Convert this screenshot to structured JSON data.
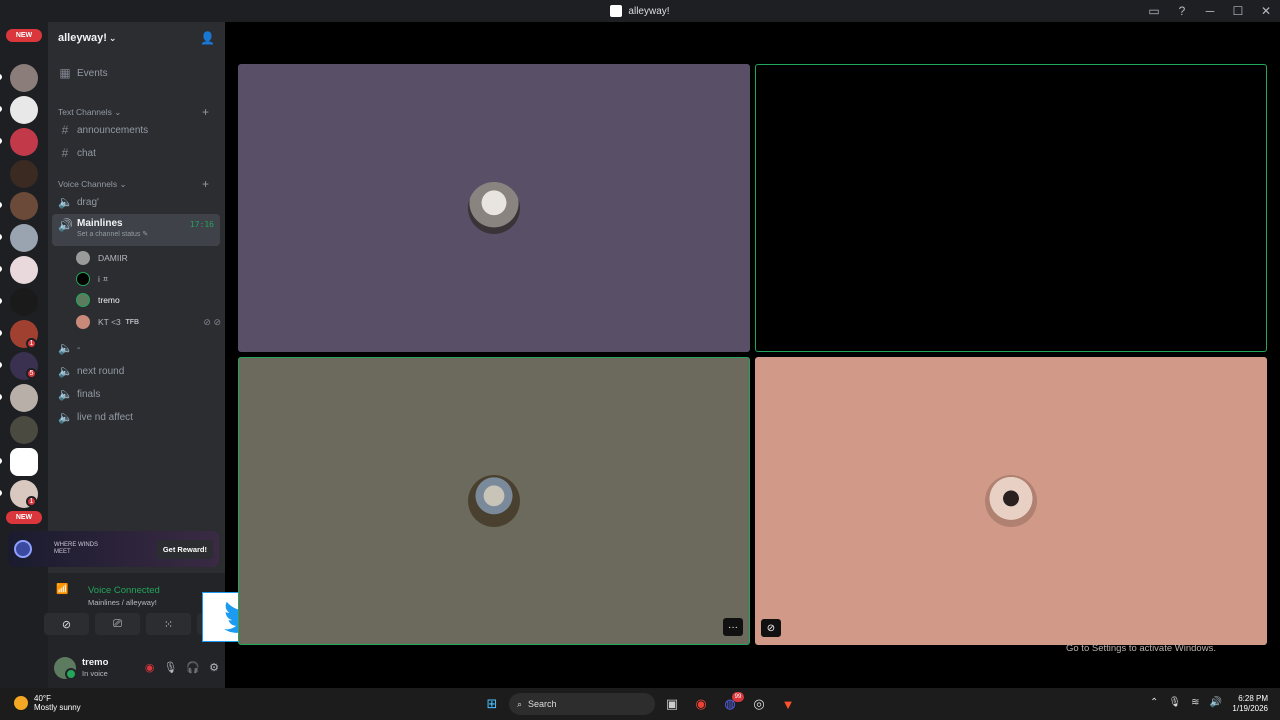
{
  "window": {
    "title": "alleyway!"
  },
  "server_rail": {
    "new_label": "NEW",
    "badge_1": "1",
    "badge_5": "5",
    "badge_1b": "1"
  },
  "server": {
    "name": "alleyway!"
  },
  "channels": {
    "events": "Events",
    "text_category": "Text Channels",
    "announcements": "announcements",
    "chat": "chat",
    "voice_category": "Voice Channels",
    "drag": "drag'",
    "mainlines": "Mainlines",
    "mainlines_time": "17:16",
    "status_prompt": "Set a channel status",
    "dash": "-",
    "next_round": "next round",
    "finals": "finals",
    "live": "live nd affect"
  },
  "voice_users": [
    {
      "name": "DAMIIR",
      "tag": ""
    },
    {
      "name": "i",
      "tag": "ㅍ"
    },
    {
      "name": "tremo",
      "tag": ""
    },
    {
      "name": "KT <3",
      "tag": "TFB"
    }
  ],
  "promo": {
    "game": "WHERE WINDS MEET",
    "button": "Get Reward!"
  },
  "voice_connection": {
    "status": "Voice Connected",
    "location": "Mainlines / alleyway!"
  },
  "user": {
    "name": "tremo",
    "status": "In voice"
  },
  "tiles": {
    "more": "···"
  },
  "watermark": "Go to Settings to activate Windows.",
  "taskbar": {
    "temp": "40°F",
    "weather": "Mostly sunny",
    "search_placeholder": "Search",
    "time": "6:28 PM",
    "date": "1/19/2026",
    "discord_badge": "99"
  },
  "colors": {
    "tile1": "#595068",
    "tile3": "#6b6a5c",
    "tile4": "#d19a88",
    "speaking": "#23a55a"
  }
}
